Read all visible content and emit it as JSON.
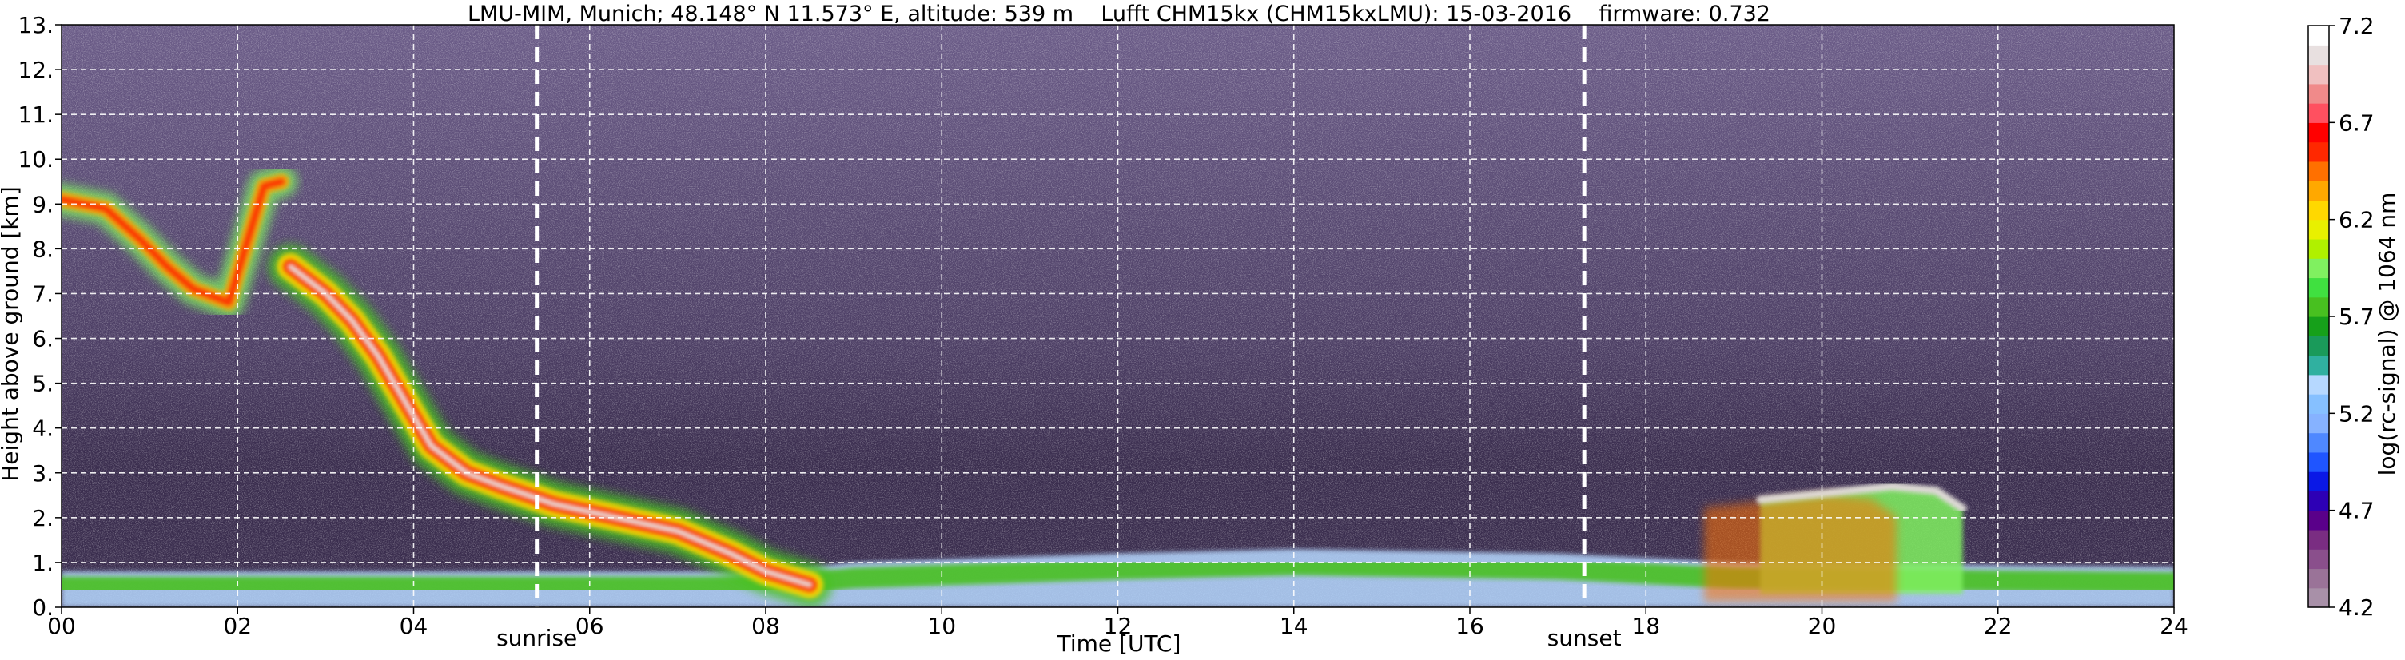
{
  "chart_data": {
    "type": "heatmap",
    "title": "LMU-MIM, Munich; 48.148° N 11.573° E, altitude: 539 m    Lufft CHM15kx (CHM15kxLMU): 15-03-2016    firmware: 0.732",
    "xlabel": "Time [UTC]",
    "ylabel": "Height above ground [km]",
    "xlim": [
      0,
      24
    ],
    "ylim": [
      0,
      13
    ],
    "x_ticks": [
      "00",
      "02",
      "04",
      "06",
      "08",
      "10",
      "12",
      "14",
      "16",
      "18",
      "20",
      "22",
      "24"
    ],
    "y_ticks": [
      "0.",
      "1.",
      "2.",
      "3.",
      "4.",
      "5.",
      "6.",
      "7.",
      "8.",
      "9.",
      "10.",
      "11.",
      "12.",
      "13."
    ],
    "grid": true,
    "colorbar": {
      "label": "log(rc-signal) @ 1064 nm",
      "range": [
        4.2,
        7.2
      ],
      "tick_labels": [
        "4.2",
        "4.7",
        "5.2",
        "5.7",
        "6.2",
        "6.7",
        "7.2"
      ],
      "tick_values": [
        4.2,
        4.7,
        5.2,
        5.7,
        6.2,
        6.7,
        7.2
      ],
      "colors": [
        "#a890a8",
        "#9a7398",
        "#8a4f8c",
        "#7a2d82",
        "#5a008a",
        "#2d00b5",
        "#0a18e6",
        "#1f55ff",
        "#4f88ff",
        "#86b2ff",
        "#86c0ff",
        "#b6d8ff",
        "#30b0a0",
        "#1a9a5a",
        "#16a01a",
        "#48c020",
        "#40e040",
        "#80f060",
        "#b0f000",
        "#e8f000",
        "#ffd800",
        "#ffa800",
        "#ff7000",
        "#ff2800",
        "#ff0000",
        "#ff5060",
        "#f08a8a",
        "#f0c0c0",
        "#e8e0e0",
        "#ffffff"
      ]
    },
    "vertical_markers": [
      {
        "label": "sunrise",
        "x": 5.4
      },
      {
        "label": "sunset",
        "x": 17.3
      }
    ],
    "features": {
      "cirrus_upper": [
        {
          "x": 0.0,
          "y": 9.1
        },
        {
          "x": 0.5,
          "y": 8.9
        },
        {
          "x": 0.9,
          "y": 8.2
        },
        {
          "x": 1.2,
          "y": 7.6
        },
        {
          "x": 1.5,
          "y": 7.1
        },
        {
          "x": 1.9,
          "y": 6.8
        },
        {
          "x": 2.3,
          "y": 9.4
        },
        {
          "x": 2.5,
          "y": 9.5
        }
      ],
      "descending_layer": [
        {
          "x": 2.6,
          "y": 7.6
        },
        {
          "x": 3.0,
          "y": 7.0
        },
        {
          "x": 3.3,
          "y": 6.4
        },
        {
          "x": 3.6,
          "y": 5.6
        },
        {
          "x": 3.9,
          "y": 4.6
        },
        {
          "x": 4.2,
          "y": 3.6
        },
        {
          "x": 4.6,
          "y": 3.0
        },
        {
          "x": 5.0,
          "y": 2.7
        },
        {
          "x": 5.6,
          "y": 2.3
        },
        {
          "x": 6.3,
          "y": 2.0
        },
        {
          "x": 7.0,
          "y": 1.7
        },
        {
          "x": 7.6,
          "y": 1.2
        },
        {
          "x": 8.0,
          "y": 0.8
        },
        {
          "x": 8.5,
          "y": 0.5
        }
      ],
      "boundary_layer_top": [
        {
          "x": 0,
          "y": 0.8
        },
        {
          "x": 8,
          "y": 0.8
        },
        {
          "x": 9,
          "y": 1.0
        },
        {
          "x": 12,
          "y": 1.2
        },
        {
          "x": 14,
          "y": 1.3
        },
        {
          "x": 17,
          "y": 1.2
        },
        {
          "x": 19,
          "y": 1.0
        },
        {
          "x": 24,
          "y": 0.9
        }
      ],
      "evening_cloud": [
        {
          "x": 19.3,
          "y": 2.4
        },
        {
          "x": 19.8,
          "y": 2.5
        },
        {
          "x": 20.3,
          "y": 2.6
        },
        {
          "x": 20.8,
          "y": 2.7
        },
        {
          "x": 21.3,
          "y": 2.6
        },
        {
          "x": 21.6,
          "y": 2.2
        }
      ]
    }
  }
}
